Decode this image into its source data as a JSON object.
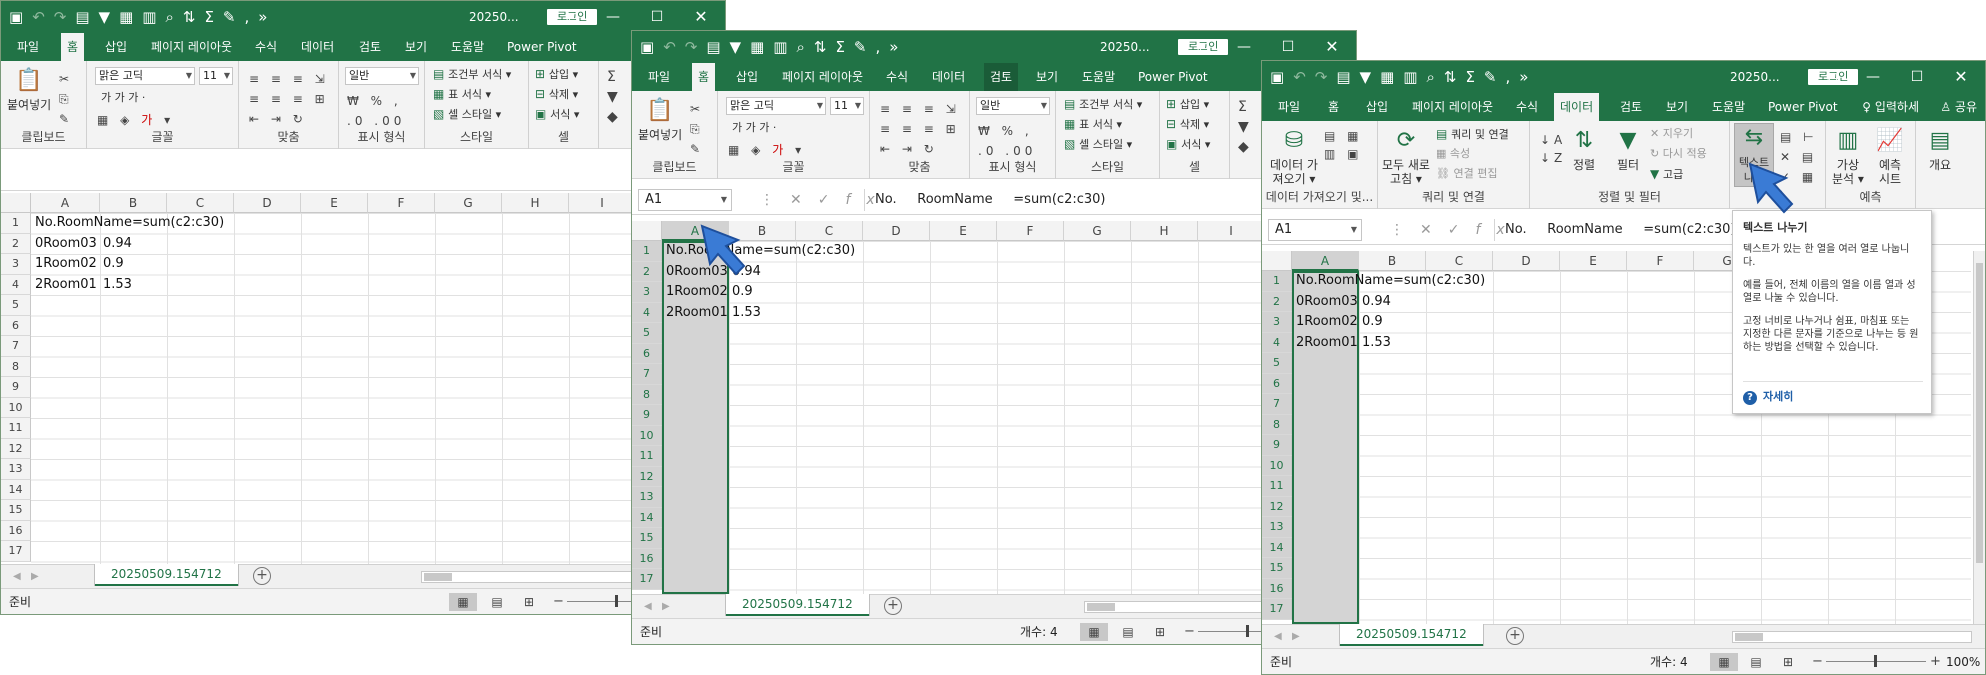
{
  "app": {
    "file_title": "20250...",
    "login_label": "로그인",
    "icons": {
      "qat": [
        "save-icon",
        "undo-icon",
        "redo-icon",
        "form-icon",
        "filter-icon",
        "pivot-icon",
        "chart-icon",
        "find-icon",
        "sort-icon",
        "sum-icon",
        "format-icon",
        "more-icon",
        "overflow-icon"
      ],
      "window": [
        "ribbon-options-icon",
        "minimize-icon",
        "maximize-icon",
        "close-icon"
      ]
    },
    "window_glyphs": {
      "ribbon_options": "⊡",
      "minimize": "—",
      "maximize": "☐",
      "close": "✕"
    }
  },
  "tabs": [
    "파일",
    "홈",
    "삽입",
    "페이지 레이아웃",
    "수식",
    "데이터",
    "검토",
    "보기",
    "도움말",
    "Power Pivot"
  ],
  "tell_me": "입력하세",
  "share": "공유",
  "home_ribbon": {
    "paste": "붙여넣기",
    "font_name": "맑은 고딕",
    "font_size": "11",
    "number_format": "일반",
    "bold_row": "가  가  가  ·",
    "cond_format": "조건부 서식 ▾",
    "table_format": "표 서식 ▾",
    "cell_style": "셀 스타일 ▾",
    "insert": "삽입 ▾",
    "delete": "삭제 ▾",
    "format": "서식 ▾",
    "groups": {
      "clipboard": "클립보드",
      "font": "글꼴",
      "align": "맞춤",
      "number": "표시 형식",
      "style": "스타일",
      "cells": "셀"
    }
  },
  "data_ribbon": {
    "get_data": "데이터 가\n져오기 ▾",
    "query_conn": "쿼리 및 연결",
    "properties": "속성",
    "edit_links": "연결 편집",
    "refresh_all": "모두 새로\n고침 ▾",
    "sort": "정렬",
    "filter": "필터",
    "clear": "지우기",
    "reapply": "다시 적용",
    "advanced": "고급",
    "text_to_columns": "텍스트\n나누",
    "what_if": "가상\n분석 ▾",
    "forecast_sheet": "예측\n시트",
    "outline": "개요",
    "groups": {
      "get": "데이터 가져오기 및...",
      "queries": "쿼리 및 연결",
      "sortfilter": "정렬 및 필터",
      "tools": "데",
      "forecast": "예측"
    }
  },
  "formula_bar": {
    "name_box": "A1",
    "fx_label": "fx",
    "formula": "No.     RoomName     =sum(c2:c30)"
  },
  "sheet": {
    "columns": [
      "A",
      "B",
      "C",
      "D",
      "E",
      "F",
      "G",
      "H",
      "I"
    ],
    "rows": [
      "1",
      "2",
      "3",
      "4",
      "5",
      "6",
      "7",
      "8",
      "9",
      "10",
      "11",
      "12",
      "13",
      "14",
      "15",
      "16",
      "17"
    ],
    "cells": {
      "a1": "No.RoomName=sum(c2:c30)",
      "a2": "0Room03",
      "b2": "0.94",
      "a3": "1Room02",
      "b3": "0.9",
      "a4": "2Room01",
      "b4": "1.53"
    }
  },
  "sheet_tab": "20250509.154712",
  "status": {
    "ready": "준비",
    "count": "개수: 4",
    "zoom": "100%",
    "view_icons": [
      "normal-view-icon",
      "page-layout-icon",
      "page-break-icon"
    ]
  },
  "tooltip": {
    "title": "텍스트 나누기",
    "p1": "텍스트가 있는 한 열을 여러 열로 나눕니다.",
    "p2": "예를 들어, 전체 이름의 열을 이름 열과 성 열로 나눌 수 있습니다.",
    "p3": "고정 너비로 나누거나 쉼표, 마침표 또는 지정한 다른 문자를 기준으로 나누는 등 원하는 방법을 선택할 수 있습니다.",
    "more": "자세히"
  },
  "colors": {
    "excel_green": "#217346",
    "cursor_blue": "#3a7bd5"
  }
}
